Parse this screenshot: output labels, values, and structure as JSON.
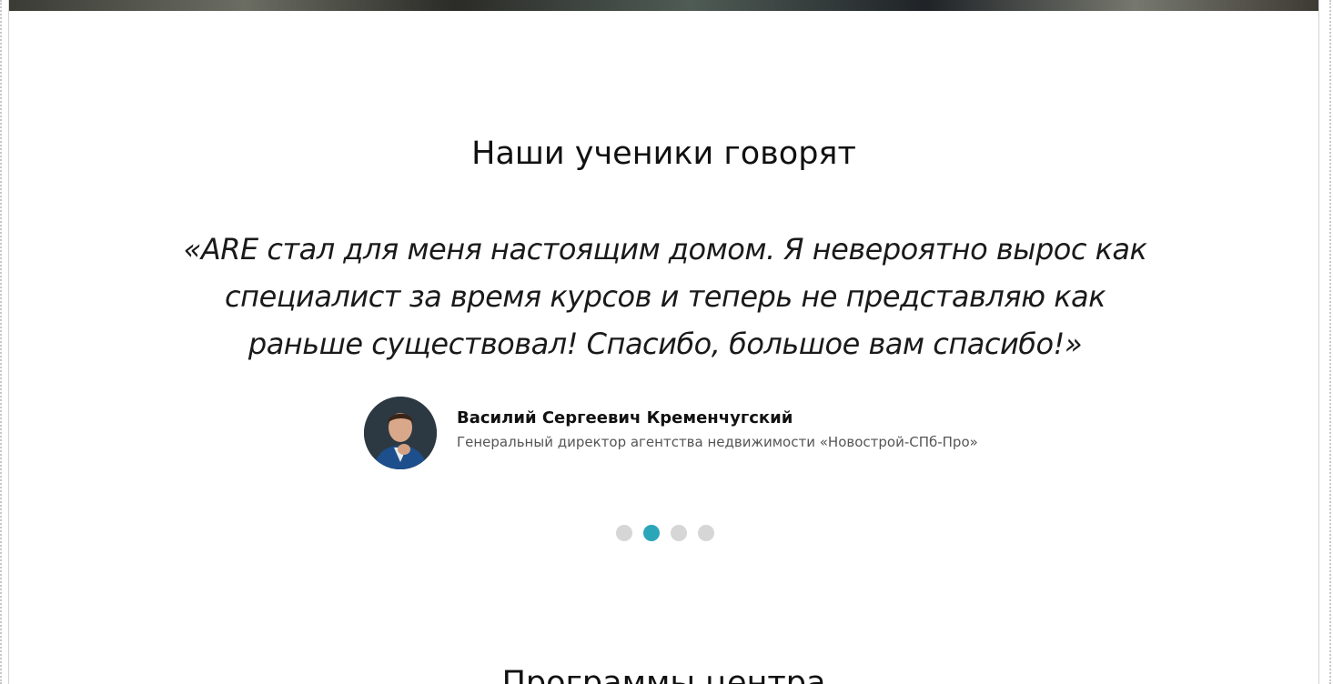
{
  "testimonials": {
    "title": "Наши ученики говорят",
    "quote": "«ARE стал для меня настоящим домом. Я невероятно вырос как специалист за время курсов и теперь не представляю как раньше существовал! Спасибо, большое вам спасибо!»",
    "author": {
      "name": "Василий Сергеевич Кременчугский",
      "role": "Генеральный директор агентства недвижимости «Новострой-СПб-Про»"
    },
    "pagination": {
      "total": 4,
      "active": 2
    },
    "accent_color": "#2ba6b8"
  },
  "programs": {
    "title": "Программы центра"
  }
}
